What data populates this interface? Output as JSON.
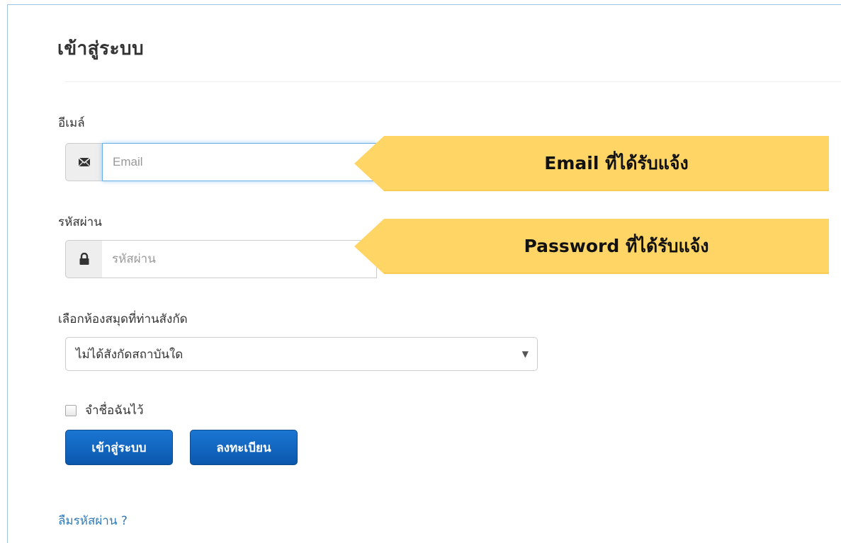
{
  "page": {
    "title": "เข้าสู่ระบบ"
  },
  "email_field": {
    "label": "อีเมล์",
    "placeholder": "Email",
    "icon": "envelope-icon",
    "callout_text": "Email ที่ได้รับแจ้ง"
  },
  "password_field": {
    "label": "รหัสผ่าน",
    "placeholder": "รหัสผ่าน",
    "icon": "lock-icon",
    "callout_text": "Password ที่ได้รับแจ้ง"
  },
  "library_select": {
    "label": "เลือกห้องสมุดที่ท่านสังกัด",
    "selected_value": "ไม่ได้สังกัดสถาบันใด",
    "arrow": "▼"
  },
  "remember_me": {
    "label": "จำชื่อฉันไว้",
    "checked": false
  },
  "buttons": {
    "login_label": "เข้าสู่ระบบ",
    "register_label": "ลงทะเบียน"
  },
  "links": {
    "forgot_password": "ลืมรหัสผ่าน ?"
  },
  "colors": {
    "callout_fill": "#ffd666",
    "button_blue": "#0b57ad",
    "link_blue": "#337ab7",
    "focus_border": "#66afe9"
  }
}
